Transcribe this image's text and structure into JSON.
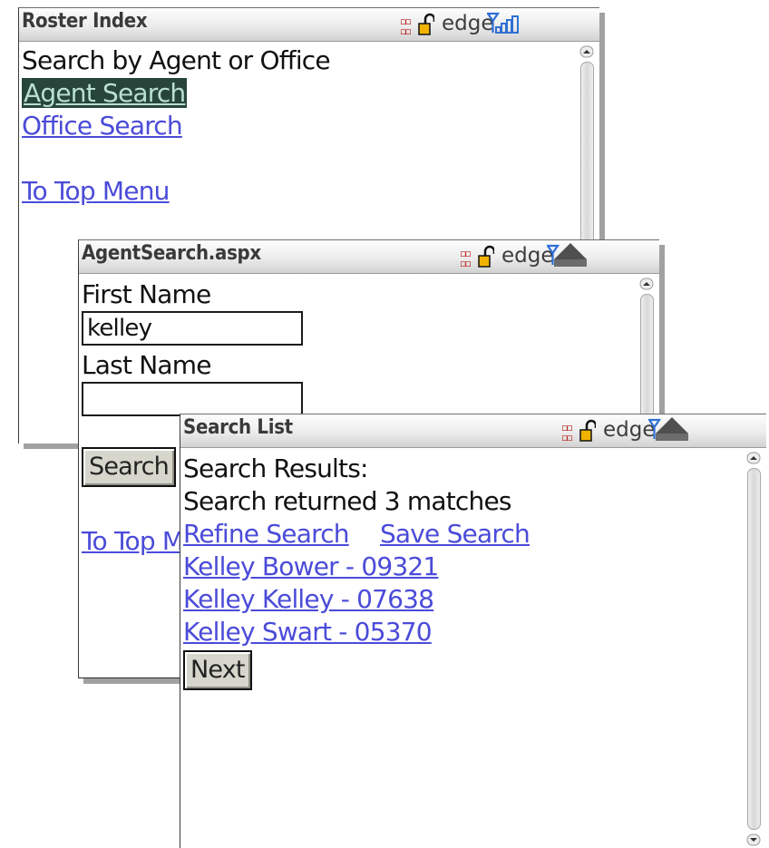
{
  "status": {
    "carrier": "edge",
    "icons": [
      "network-icon",
      "lock-icon",
      "signal-icon"
    ]
  },
  "roster": {
    "title": "Roster Index",
    "heading": "Search by Agent or Office",
    "links": {
      "agent_search": "Agent Search",
      "office_search": "Office Search",
      "top_menu": "To Top Menu"
    }
  },
  "agent_search": {
    "title": "AgentSearch.aspx",
    "first_name_label": "First Name",
    "first_name_value": "kelley",
    "last_name_label": "Last Name",
    "last_name_value": "",
    "search_button": "Search",
    "top_menu_link": "To Top Menu"
  },
  "search_list": {
    "title": "Search List",
    "results_label": "Search Results:",
    "summary": "Search returned 3 matches",
    "refine_link": "Refine Search",
    "save_link": "Save Search",
    "results": [
      "Kelley Bower - 09321",
      "Kelley Kelley - 07638",
      "Kelley Swart - 05370"
    ],
    "next_button": "Next"
  },
  "colors": {
    "link": "#4b4bd9",
    "selected_bg": "#27453b",
    "selected_text": "#b9dfd4",
    "signal": "#2f6fd6",
    "lock": "#e6a400"
  }
}
